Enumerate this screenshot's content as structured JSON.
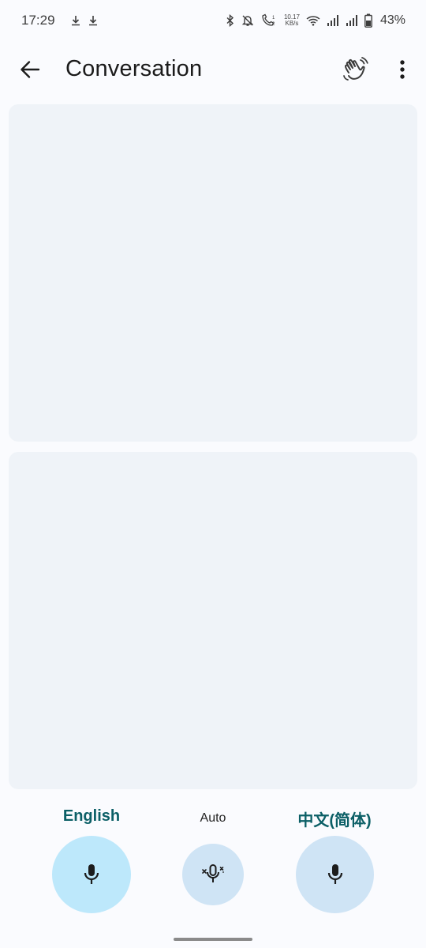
{
  "status_bar": {
    "time": "17:29",
    "speed_value": "10.17",
    "speed_unit": "KB/s",
    "battery_percent": "43%",
    "icons": [
      "download-icon",
      "download-icon",
      "bluetooth-icon",
      "bell-off-icon",
      "volte-call-icon",
      "wifi-icon",
      "signal-icon",
      "signal-icon",
      "battery-icon"
    ]
  },
  "app_bar": {
    "title": "Conversation",
    "back_icon": "arrow-back-icon",
    "wave_icon": "waving-hand-icon",
    "more_icon": "more-vert-icon"
  },
  "controls": {
    "left_language": "English",
    "auto_label": "Auto",
    "right_language": "中文(简体)",
    "mic_icon": "mic-icon",
    "auto_mic_icon": "auto-mic-icon"
  },
  "colors": {
    "background": "#fafbfe",
    "panel": "#eff3f8",
    "accent_text": "#0b5f66",
    "mic_active": "#bde8fb",
    "mic_inactive": "#cfe4f5"
  }
}
